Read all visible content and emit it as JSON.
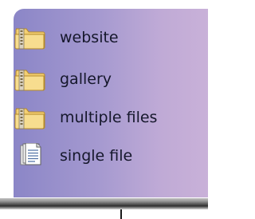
{
  "menu": {
    "items": [
      {
        "label": "website",
        "icon": "zip-folder-icon"
      },
      {
        "label": "gallery",
        "icon": "zip-folder-icon"
      },
      {
        "label": "multiple files",
        "icon": "zip-folder-icon"
      },
      {
        "label": "single file",
        "icon": "document-icon"
      }
    ]
  },
  "colors": {
    "panel_gradient_start": "#8b86c7",
    "panel_gradient_end": "#c9b1d8",
    "label_text": "#15172b",
    "folder_fill": "#f4d27a"
  }
}
